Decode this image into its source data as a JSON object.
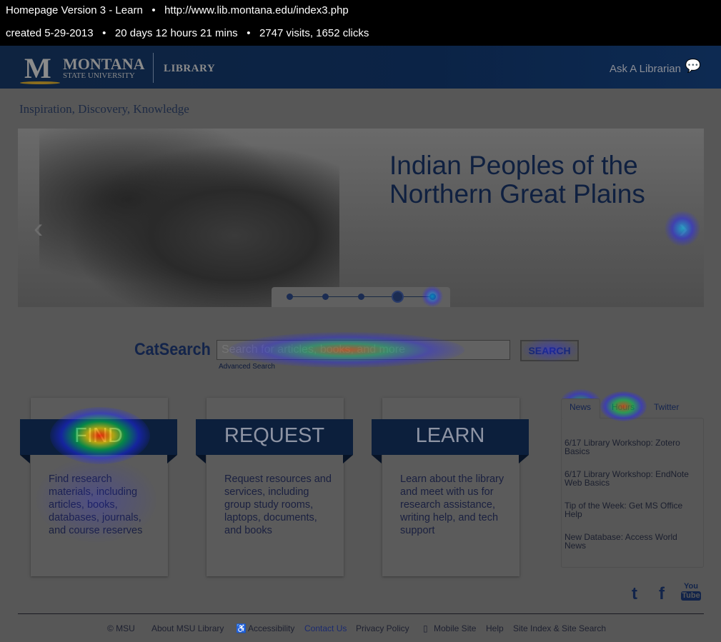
{
  "report": {
    "title": "Homepage Version 3 - Learn",
    "url": "http://www.lib.montana.edu/index3.php",
    "created": "created 5-29-2013",
    "duration": "20 days 12 hours 21 mins",
    "stats": "2747 visits, 1652 clicks",
    "separator": "•"
  },
  "header": {
    "logo_letter": "M",
    "logo_name": "MONTANA",
    "logo_sub": "STATE UNIVERSITY",
    "library": "LIBRARY",
    "ask": "Ask A Librarian"
  },
  "tagline": "Inspiration, Discovery, Knowledge",
  "hero": {
    "title_line1": "Indian Peoples of the",
    "title_line2": "Northern Great Plains",
    "slide_count": 5,
    "active_slide": 4
  },
  "catsearch": {
    "label": "CatSearch",
    "placeholder": "Search for articles, books, and more",
    "advanced": "Advanced Search",
    "button": "SEARCH"
  },
  "cards": [
    {
      "title": "FIND",
      "text": "Find research materials, including articles, books, databases, journals, and course reserves"
    },
    {
      "title": "REQUEST",
      "text": "Request resources and services, including group study rooms, laptops, documents, and books"
    },
    {
      "title": "LEARN",
      "text": "Learn about the library and meet with us for research assistance, writing help, and tech support"
    }
  ],
  "news": {
    "tabs": [
      "News",
      "Hours",
      "Twitter"
    ],
    "items": [
      "6/17 Library Workshop: Zotero Basics",
      "6/17 Library Workshop: EndNote Web Basics",
      "Tip of the Week: Get MS Office Help",
      "New Database: Access World News"
    ]
  },
  "social": {
    "twitter": "t",
    "facebook": "f",
    "youtube_top": "You",
    "youtube_bottom": "Tube"
  },
  "footer": {
    "links": [
      "© MSU",
      "About MSU Library",
      "Accessibility",
      "Contact Us",
      "Privacy Policy",
      "Mobile Site",
      "Help",
      "Site Index & Site Search"
    ]
  }
}
